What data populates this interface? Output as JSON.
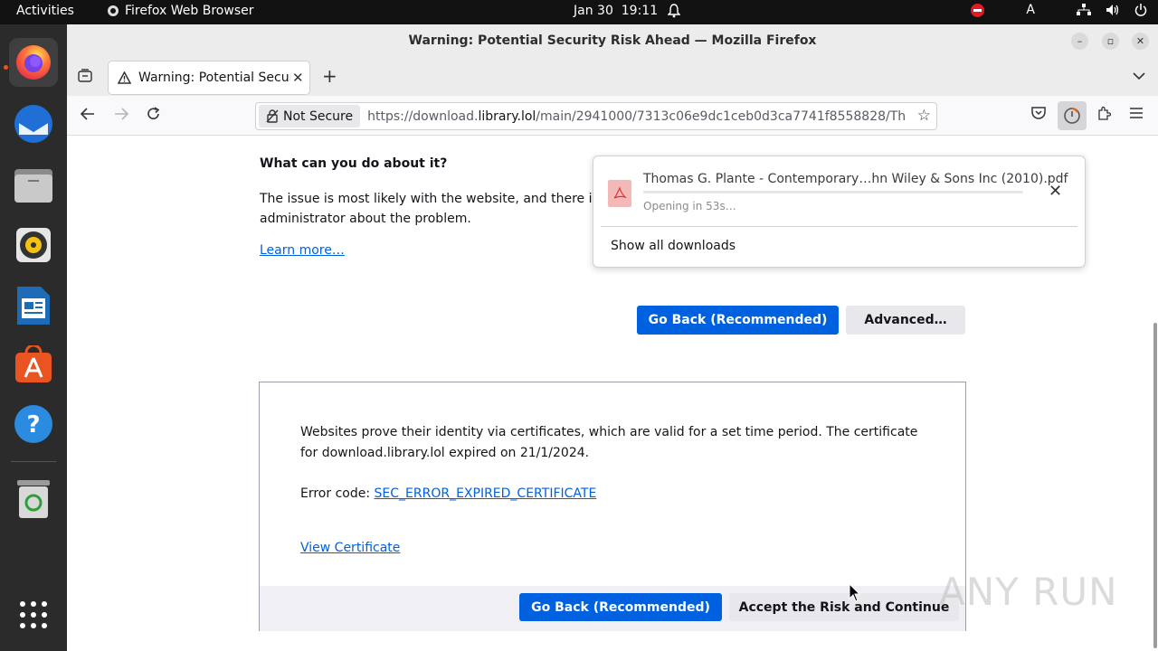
{
  "topbar": {
    "activities": "Activities",
    "app_name": "Firefox Web Browser",
    "date": "Jan 30",
    "time": "19:11",
    "lang": "A"
  },
  "window": {
    "title": "Warning: Potential Security Risk Ahead — Mozilla Firefox"
  },
  "tab": {
    "title": "Warning: Potential Security Risk Ahead"
  },
  "urlbar": {
    "security_label": "Not Secure",
    "url_prefix": "https://download.",
    "url_domain": "library.lol",
    "url_path": "/main/2941000/7313c06e9dc1ceb0d3ca7741f8558828/Th"
  },
  "page": {
    "what_heading": "What can you do about it?",
    "issue_text": "The issue is most likely with the website, and there is nothing you can do to resolve it. You can notify the website's administrator about the problem.",
    "issue_line1": "The issue is most likely with the website, and there is n",
    "issue_line2": "administrator about the problem.",
    "learn_more": "Learn more…",
    "go_back_label": "Go Back (Recommended)",
    "advanced_label": "Advanced…",
    "cert_text": "Websites prove their identity via certificates, which are valid for a set time period. The certificate for download.library.lol expired on 21/1/2024.",
    "error_code_label": "Error code: ",
    "error_code": "SEC_ERROR_EXPIRED_CERTIFICATE",
    "view_certificate": "View Certificate",
    "accept_label": "Accept the Risk and Continue"
  },
  "downloads": {
    "file_name": "Thomas G. Plante - Contemporary…hn Wiley & Sons Inc (2010).pdf",
    "status": "Opening in 53s…",
    "show_all": "Show all downloads"
  },
  "watermark": "ANY RUN",
  "colors": {
    "accent": "#0061e0",
    "topbar": "#121212",
    "dock": "#2b2b2b"
  }
}
